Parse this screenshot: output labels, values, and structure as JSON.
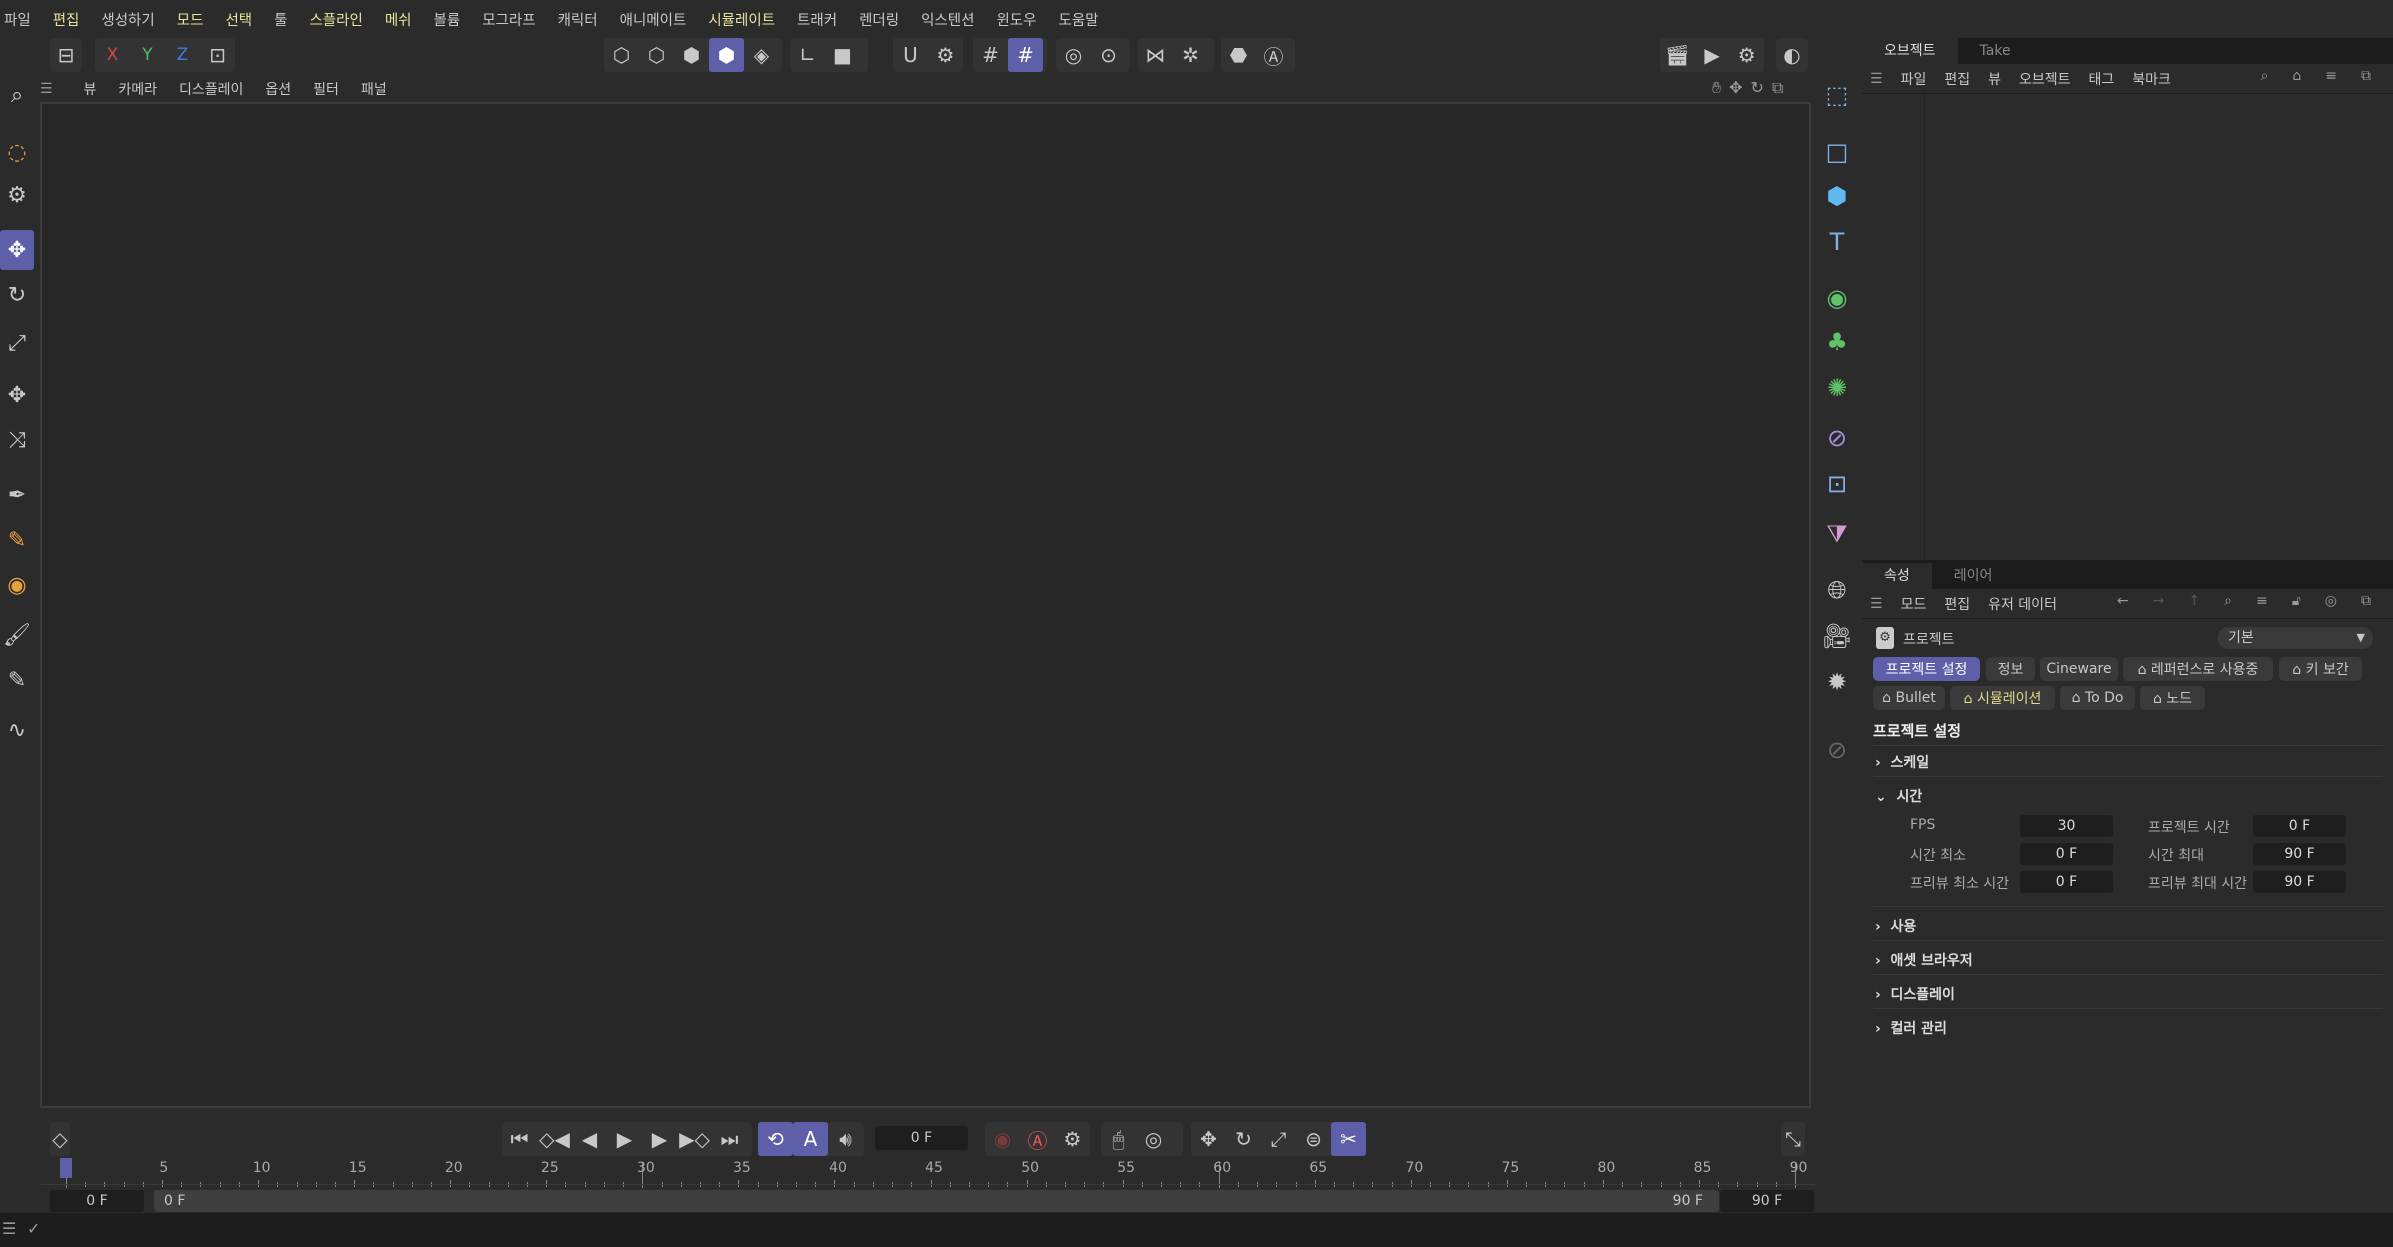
{
  "menu": [
    {
      "label": "파일"
    },
    {
      "label": "편집",
      "hl": true
    },
    {
      "label": "생성하기"
    },
    {
      "label": "모드",
      "hl": true
    },
    {
      "label": "선택",
      "hl": true
    },
    {
      "label": "툴"
    },
    {
      "label": "스플라인",
      "hl": true
    },
    {
      "label": "메쉬",
      "hl": true
    },
    {
      "label": "볼륨"
    },
    {
      "label": "모그라프"
    },
    {
      "label": "캐릭터"
    },
    {
      "label": "애니메이트"
    },
    {
      "label": "시뮬레이트",
      "hl": true
    },
    {
      "label": "트래커"
    },
    {
      "label": "렌더링"
    },
    {
      "label": "익스텐션"
    },
    {
      "label": "윈도우"
    },
    {
      "label": "도움말"
    }
  ],
  "toolbar": {
    "axis_x": "X",
    "axis_y": "Y",
    "axis_z": "Z",
    "axis_colors": {
      "x": "#d04848",
      "y": "#4cc060",
      "z": "#3a7fd8"
    }
  },
  "viewport_menu": [
    "뷰",
    "카메라",
    "디스플레이",
    "옵션",
    "필터",
    "패널"
  ],
  "object_manager": {
    "tabs": [
      "오브젝트",
      "Take"
    ],
    "menu": [
      "파일",
      "편집",
      "뷰",
      "오브젝트",
      "태그",
      "북마크"
    ]
  },
  "attributes": {
    "tabs": [
      "속성",
      "레이어"
    ],
    "menu": [
      "모드",
      "편집",
      "유저 데이터"
    ],
    "object": "프로젝트",
    "preset": "기본",
    "buttons_row1": [
      "프로젝트 설정",
      "정보",
      "Cineware",
      "⌂ 레퍼런스로 사용중",
      "⌂ 키 보간"
    ],
    "buttons_row2": [
      "⌂ Bullet",
      "⌂ 시뮬레이션",
      "⌂ To Do",
      "⌂ 노드"
    ],
    "title": "프로젝트 설정",
    "sections": {
      "scale": "스케일",
      "time": "시간",
      "use": "사용",
      "asset": "애셋 브라우저",
      "display": "디스플레이",
      "color": "컬러 관리"
    },
    "fields": [
      {
        "label": "FPS",
        "value": "30",
        "label2": "프로젝트 시간",
        "value2": "0 F"
      },
      {
        "label": "시간 최소",
        "value": "0 F",
        "label2": "시간 최대",
        "value2": "90 F"
      },
      {
        "label": "프리뷰 최소 시간",
        "value": "0 F",
        "label2": "프리뷰 최대 시간",
        "value2": "90 F"
      }
    ]
  },
  "timeline": {
    "current_frame": "0 F",
    "start": "0 F",
    "range_start": "0 F",
    "range_end": "90 F",
    "end": "90 F",
    "min": 0,
    "max": 90,
    "label_step": 5,
    "accent": "#5d5fa8"
  }
}
